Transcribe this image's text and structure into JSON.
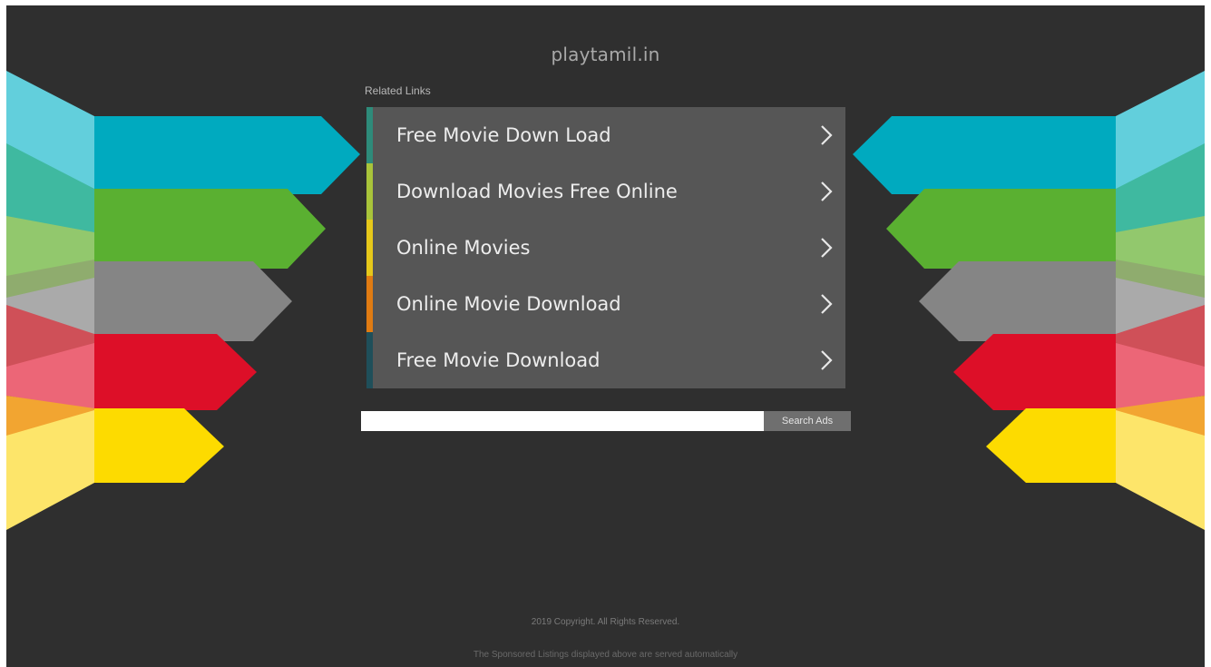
{
  "site": {
    "title": "playtamil.in"
  },
  "related": {
    "label": "Related Links",
    "links": [
      {
        "label": "Free Movie Down Load",
        "accent": "#2e8b7a"
      },
      {
        "label": "Download Movies Free Online",
        "accent": "#a9c43a"
      },
      {
        "label": "Online Movies",
        "accent": "#e6c81a"
      },
      {
        "label": "Online Movie Download",
        "accent": "#e07b12"
      },
      {
        "label": "Free Movie Download",
        "accent": "#1f4f5a"
      }
    ]
  },
  "search": {
    "button_label": "Search Ads",
    "placeholder": ""
  },
  "footer": {
    "copyright": "2019 Copyright. All Rights Reserved.",
    "note": "The Sponsored Listings displayed above are served automatically"
  },
  "colors": {
    "background": "#2f2f2f",
    "panel": "#565656",
    "ribbons": [
      "#00aabf",
      "#5ab031",
      "#848484",
      "#dd0f28",
      "#fddb00"
    ]
  }
}
